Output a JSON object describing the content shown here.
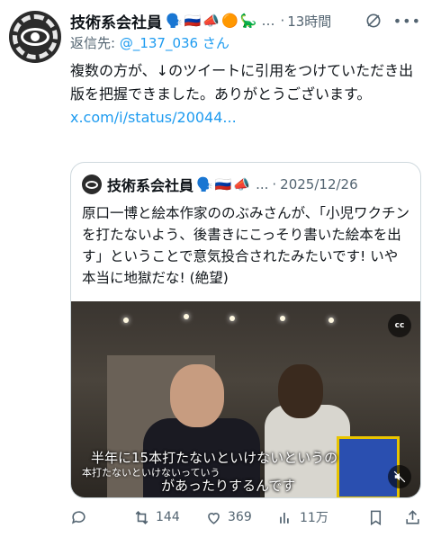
{
  "tweet": {
    "author_name": "技術系会社員",
    "emojis": [
      "🗣️",
      "🇷🇺",
      "📣",
      "🟠",
      "🦕"
    ],
    "more_dots": "…",
    "separator": "·",
    "time": "13時間",
    "reply_prefix": "返信先: ",
    "reply_handle": "@_137_036",
    "reply_suffix": " さん",
    "body": "複数の方が、↓のツイートに引用をつけていただき出版を把握できました。ありがとうございます。",
    "link": "x.com/i/status/20044..."
  },
  "quote": {
    "author_name": "技術系会社員",
    "emojis": [
      "🗣️",
      "🇷🇺",
      "📣"
    ],
    "more_dots": "...",
    "separator": "·",
    "date": "2025/12/26",
    "body": "原口一博と絵本作家ののぶみさんが、「小児ワクチンを打たないよう、後書きにこっそり書いた絵本を出す」ということで意気投合されたみたいです! いや本当に地獄だな! (絶望)",
    "video": {
      "subtitle_main": "半年に15本打たないといけないというの",
      "subtitle_small": "本打たないといけないっていう",
      "subtitle_second": "があったりするんです",
      "cc_label": "cc"
    }
  },
  "actions": {
    "replies": "",
    "retweets": "144",
    "likes": "369",
    "views": "11万"
  },
  "colors": {
    "link": "#1d9bf0",
    "muted": "#536471"
  }
}
